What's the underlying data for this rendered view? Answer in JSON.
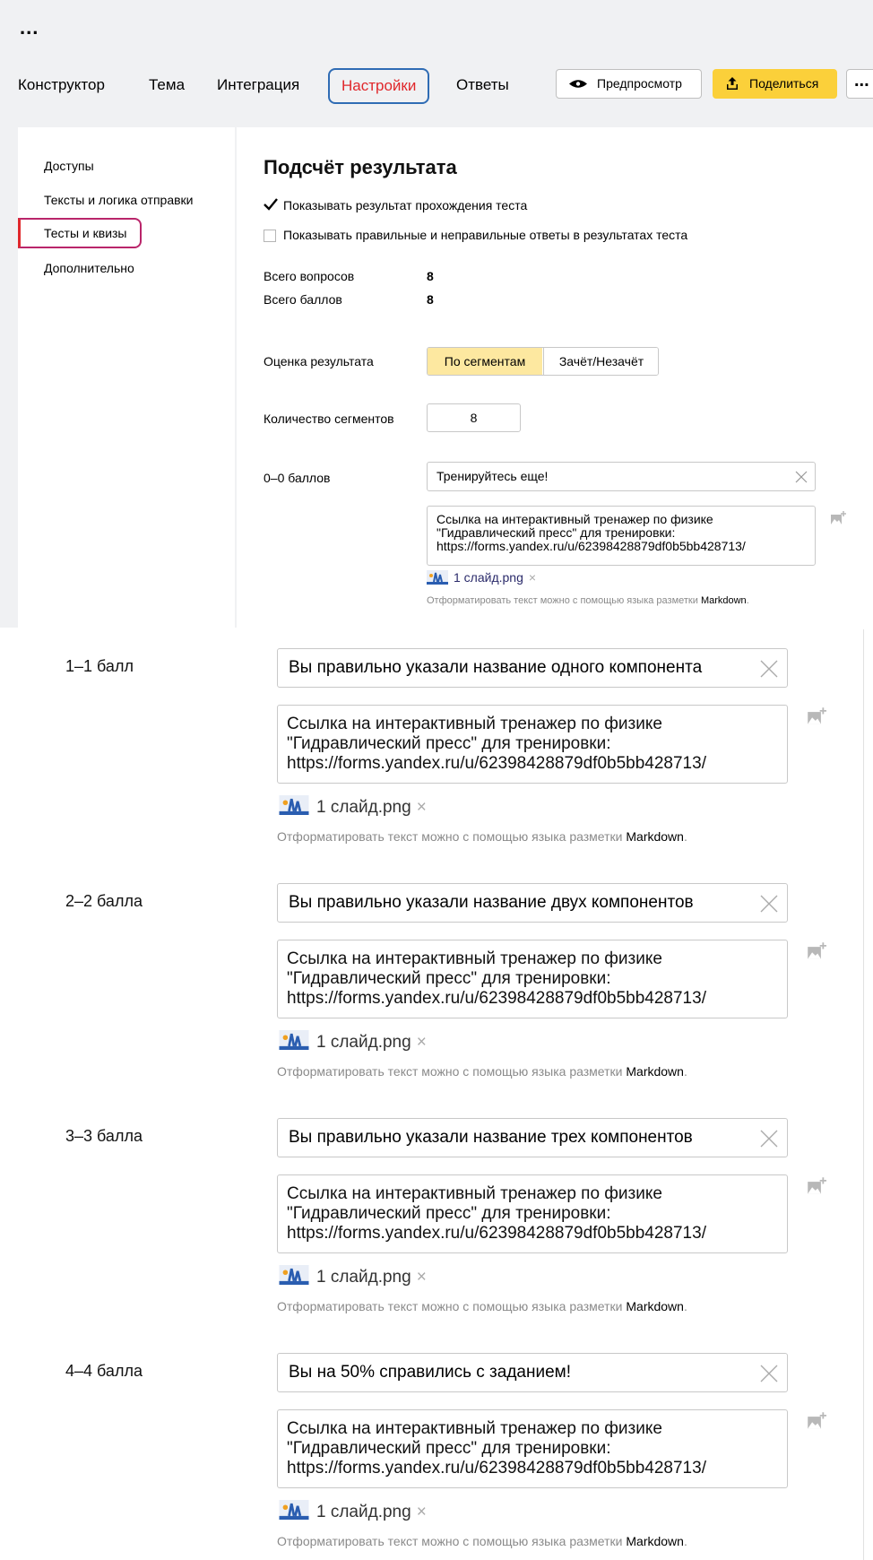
{
  "toolbar": {
    "more_glyph": "...",
    "tabs": [
      "Конструктор",
      "Тема",
      "Интеграция",
      "Настройки",
      "Ответы"
    ],
    "active_tab": "Настройки",
    "preview_label": "Предпросмотр",
    "share_label": "Поделиться",
    "more_button": "..."
  },
  "sidebar": {
    "items": [
      "Доступы",
      "Тексты и логика отправки",
      "Тесты и квизы",
      "Дополнительно"
    ],
    "active": "Тесты и квизы"
  },
  "main": {
    "title": "Подсчёт результата",
    "checkbox_show_result": {
      "label": "Показывать результат прохождения теста",
      "checked": true
    },
    "checkbox_show_answers": {
      "label": "Показывать правильные и неправильные ответы в результатах теста",
      "checked": false
    },
    "total_questions_label": "Всего вопросов",
    "total_questions": "8",
    "total_points_label": "Всего баллов",
    "total_points": "8",
    "evaluation_label": "Оценка результата",
    "evaluation_options": [
      "По сегментам",
      "Зачёт/Незачёт"
    ],
    "evaluation_selected": "По сегментам",
    "segments_count_label": "Количество сегментов",
    "segments_count": "8",
    "hint_prefix": "Отформатировать текст можно с помощью языка разметки ",
    "hint_link": "Markdown",
    "hint_suffix": ".",
    "segments": [
      {
        "range": "0–0 баллов",
        "title": "Тренируйтесь еще!",
        "text": "Ссылка на интерактивный тренажер по физике\n\"Гидравлический пресс\" для тренировки:\nhttps://forms.yandex.ru/u/62398428879df0b5bb428713/",
        "attachment": "1 слайд.png"
      },
      {
        "range": "1–1 балл",
        "title": "Вы правильно указали название одного компонента",
        "text": "Ссылка на интерактивный тренажер по физике\n\"Гидравлический пресс\" для тренировки:\nhttps://forms.yandex.ru/u/62398428879df0b5bb428713/",
        "attachment": "1 слайд.png"
      },
      {
        "range": "2–2 балла",
        "title": "Вы правильно указали название двух компонентов",
        "text": "Ссылка на интерактивный тренажер по физике\n\"Гидравлический пресс\" для тренировки:\nhttps://forms.yandex.ru/u/62398428879df0b5bb428713/",
        "attachment": "1 слайд.png"
      },
      {
        "range": "3–3 балла",
        "title": "Вы правильно указали название трех компонентов",
        "text": "Ссылка на интерактивный тренажер по физике\n\"Гидравлический пресс\" для тренировки:\nhttps://forms.yandex.ru/u/62398428879df0b5bb428713/",
        "attachment": "1 слайд.png"
      },
      {
        "range": "4–4 балла",
        "title": "Вы на 50% справились с заданием!",
        "text": "Ссылка на интерактивный тренажер по физике\n\"Гидравлический пресс\" для тренировки:\nhttps://forms.yandex.ru/u/62398428879df0b5bb428713/",
        "attachment": "1 слайд.png"
      }
    ]
  },
  "colors": {
    "accent_red": "#e0272b",
    "active_border": "#2f6cb4",
    "share_yellow": "#fbd03a",
    "segment_on": "#fde8a0"
  }
}
